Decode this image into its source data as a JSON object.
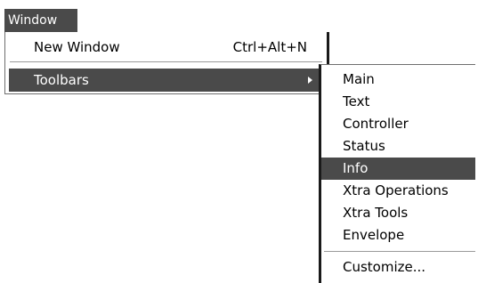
{
  "menubar": {
    "window_label": "Window"
  },
  "window_menu": {
    "items": [
      {
        "label": "New Window",
        "shortcut": "Ctrl+Alt+N"
      },
      {
        "label": "Toolbars",
        "submenu_arrow": "right-triangle-icon"
      }
    ]
  },
  "toolbars_submenu": {
    "items": [
      {
        "label": "Main"
      },
      {
        "label": "Text"
      },
      {
        "label": "Controller"
      },
      {
        "label": "Status"
      },
      {
        "label": "Info"
      },
      {
        "label": "Xtra Operations"
      },
      {
        "label": "Xtra Tools"
      },
      {
        "label": "Envelope"
      },
      {
        "label": "Customize..."
      }
    ],
    "highlighted_item": "Info"
  },
  "colors": {
    "highlight": "#4a4a4a",
    "highlight_text": "#ffffff",
    "menu_background": "#ffffff"
  }
}
